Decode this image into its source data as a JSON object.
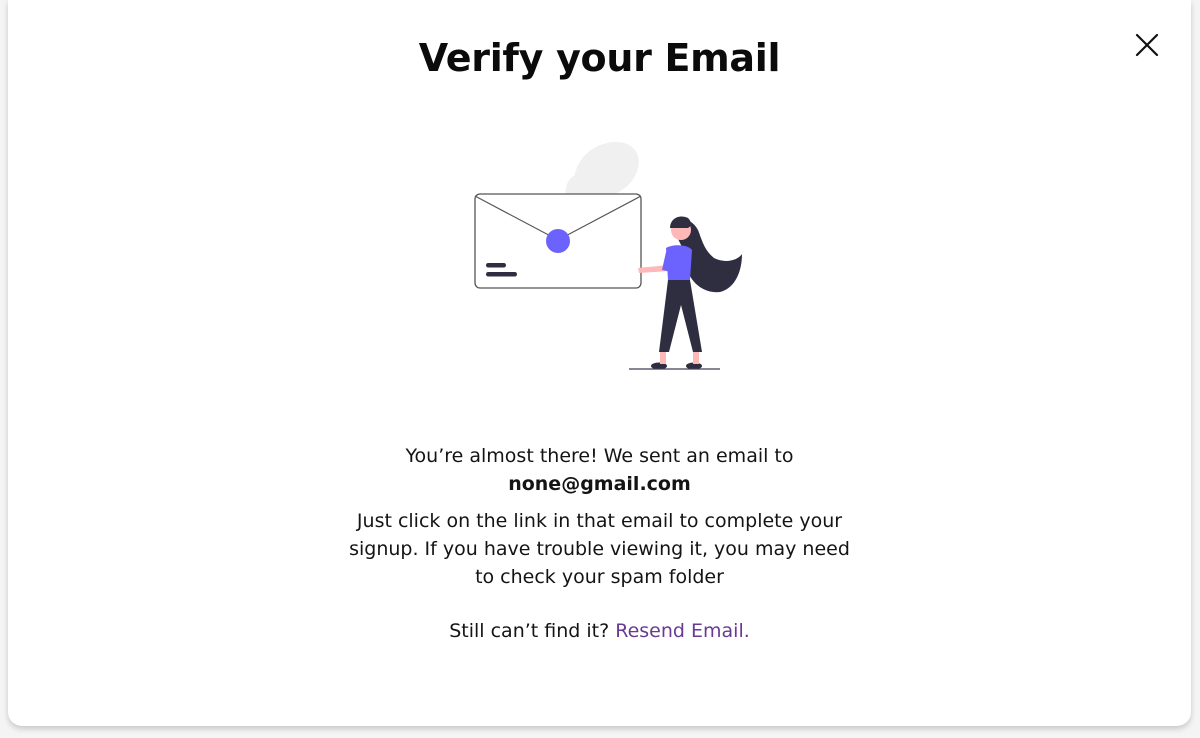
{
  "modal": {
    "title": "Verify your Email",
    "close_icon": "close-icon"
  },
  "message": {
    "intro": "You’re almost there! We sent an email to",
    "email": "none@gmail.com",
    "instructions_1": "Just click on the link in that email to complete your",
    "instructions_2": "signup. If you have trouble viewing it, you may need",
    "instructions_3": "to check your spam folder"
  },
  "resend": {
    "prompt": "Still can’t find it?",
    "link_label": "Resend Email."
  },
  "colors": {
    "accent": "#6c63ff",
    "link": "#6a3a93",
    "figure_dark": "#2f2e41",
    "skin": "#ffb8b8"
  }
}
